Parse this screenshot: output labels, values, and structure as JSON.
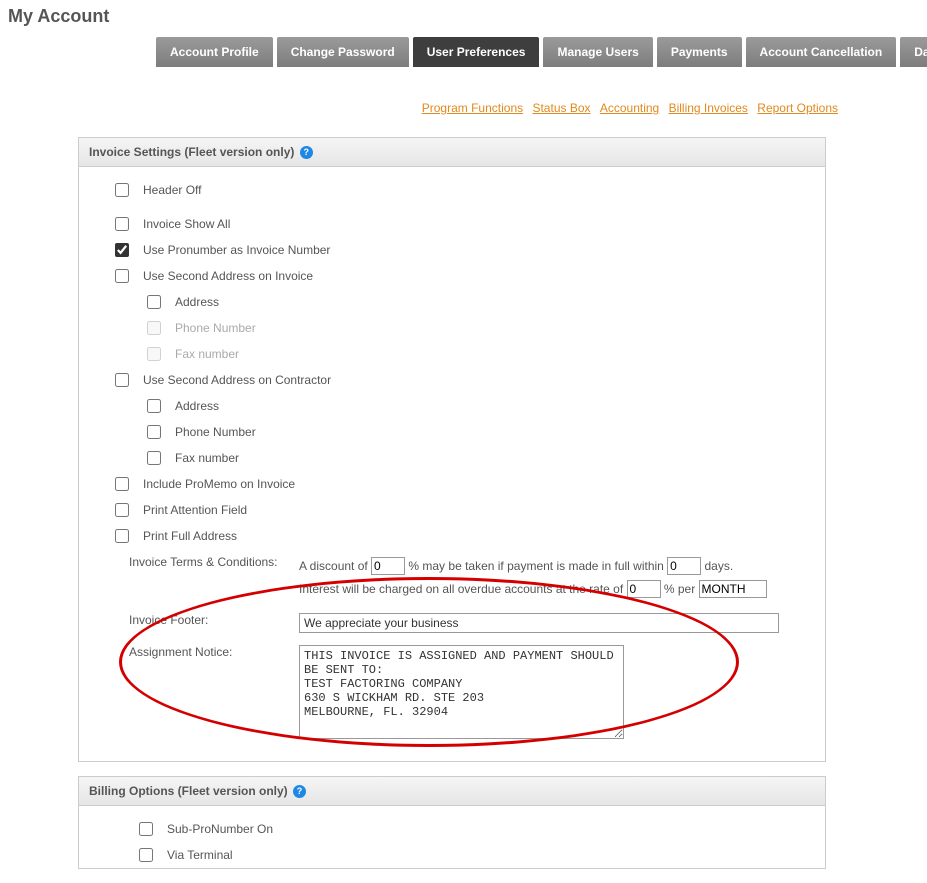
{
  "page_title": "My Account",
  "tabs": [
    {
      "label": "Account Profile",
      "active": false
    },
    {
      "label": "Change Password",
      "active": false
    },
    {
      "label": "User Preferences",
      "active": true
    },
    {
      "label": "Manage Users",
      "active": false
    },
    {
      "label": "Payments",
      "active": false
    },
    {
      "label": "Account Cancellation",
      "active": false
    },
    {
      "label": "Data Import",
      "active": false
    }
  ],
  "sublinks": [
    "Program Functions",
    "Status Box",
    "Accounting",
    "Billing Invoices",
    "Report Options"
  ],
  "invoice_panel": {
    "title": "Invoice Settings (Fleet version only)",
    "options": {
      "header_off": "Header Off",
      "invoice_show_all": "Invoice Show All",
      "use_pronumber": "Use Pronumber as Invoice Number",
      "use_second_addr_invoice": "Use Second Address on Invoice",
      "address": "Address",
      "phone_number": "Phone Number",
      "fax_number": "Fax number",
      "use_second_addr_contractor": "Use Second Address on Contractor",
      "include_promemo": "Include ProMemo on Invoice",
      "print_attention": "Print Attention Field",
      "print_full_address": "Print Full Address"
    },
    "terms_label": "Invoice Terms & Conditions:",
    "terms_line1_pre": "A discount of ",
    "terms_line1_mid": " % may be taken if payment is made in full within ",
    "terms_line1_post": " days.",
    "terms_line2_pre": "Interest will be charged on all overdue accounts at the rate of ",
    "terms_line2_mid": " % per ",
    "terms_discount_pct": "0",
    "terms_within_days": "0",
    "terms_interest_rate": "0",
    "terms_interest_period": "MONTH",
    "footer_label": "Invoice Footer:",
    "footer_value": "We appreciate your business",
    "assignment_label": "Assignment Notice:",
    "assignment_value": "THIS INVOICE IS ASSIGNED AND PAYMENT SHOULD BE SENT TO:\nTEST FACTORING COMPANY\n630 S WICKHAM RD. STE 203\nMELBOURNE, FL. 32904"
  },
  "billing_panel": {
    "title": "Billing Options (Fleet version only)",
    "sub_pronumber": "Sub-ProNumber On",
    "via_terminal": "Via Terminal"
  }
}
